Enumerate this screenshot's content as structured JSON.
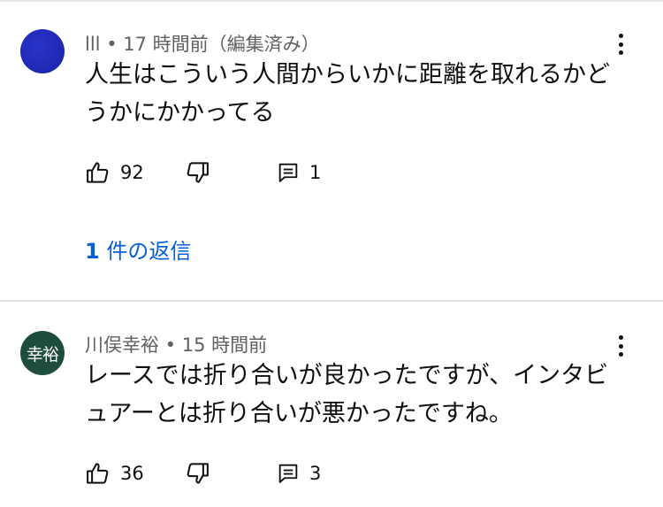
{
  "comments": [
    {
      "author": "lll",
      "separator": " • ",
      "time": "17 時間前（編集済み）",
      "avatar_text": "",
      "avatar_color": "#1a23a8",
      "text_line1": "人生はこういう人間からいかに距離を取れるかど",
      "text_line2": "うかにかかってる",
      "likes": "92",
      "replies_count": "1",
      "replies_link_num": "1",
      "replies_link_text": " 件の返信"
    },
    {
      "author": "川俣幸裕",
      "separator": " • ",
      "time": "15 時間前",
      "avatar_text": "幸裕",
      "avatar_color": "#1f4d3b",
      "text_line1": "レースでは折り合いが良かったですが、インタビ",
      "text_line2": "ュアーとは折り合いが悪かったですね。",
      "likes": "36",
      "replies_count": "3"
    }
  ],
  "icons": {
    "like": "thumbs-up-icon",
    "dislike": "thumbs-down-icon",
    "reply": "comment-reply-icon",
    "more": "more-vertical-icon"
  },
  "colors": {
    "link": "#065fd4",
    "meta": "#606060",
    "divider": "#e5e5e5"
  }
}
